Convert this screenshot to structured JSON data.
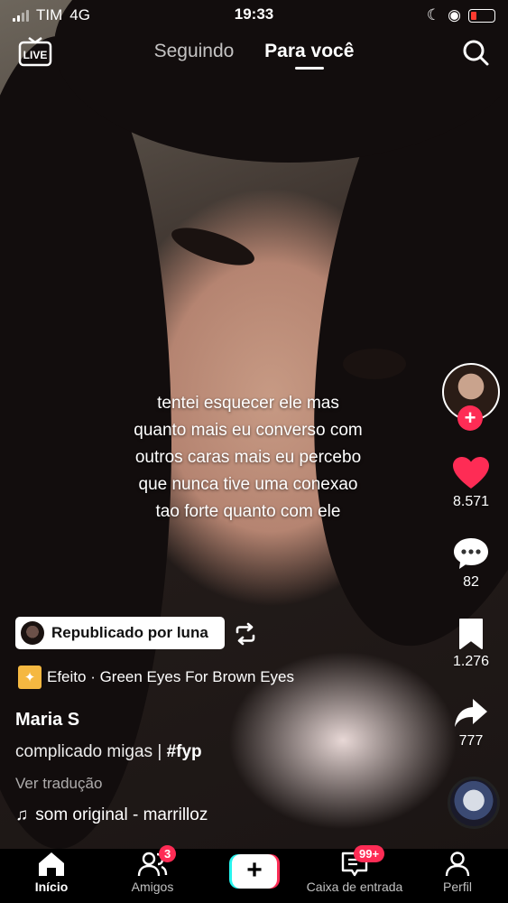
{
  "status_bar": {
    "carrier": "TIM",
    "network": "4G",
    "time": "19:33"
  },
  "top_nav": {
    "tab_following": "Seguindo",
    "tab_for_you": "Para você",
    "live_label": "LIVE"
  },
  "video": {
    "caption_lines": [
      "tentei esquecer ele mas",
      "quanto mais eu converso com",
      "outros caras mais eu percebo",
      "que nunca tive uma conexao",
      "tao forte quanto com ele"
    ]
  },
  "actions": {
    "likes": "8.571",
    "comments": "82",
    "saves": "1.276",
    "shares": "777"
  },
  "repost": {
    "label": "Republicado por luna"
  },
  "effect": {
    "label": "Efeito · Green Eyes For Brown Eyes"
  },
  "post": {
    "username": "Maria S",
    "description": "complicado migas | ",
    "hashtag": "#fyp",
    "translate": "Ver tradução",
    "sound": "som original - marrilloz"
  },
  "bottom_nav": {
    "home": "Início",
    "friends": "Amigos",
    "friends_badge": "3",
    "inbox": "Caixa de entrada",
    "inbox_badge": "99+",
    "profile": "Perfil"
  },
  "colors": {
    "accent": "#fe2c55",
    "cyan": "#25f4ee",
    "background": "#000000"
  }
}
